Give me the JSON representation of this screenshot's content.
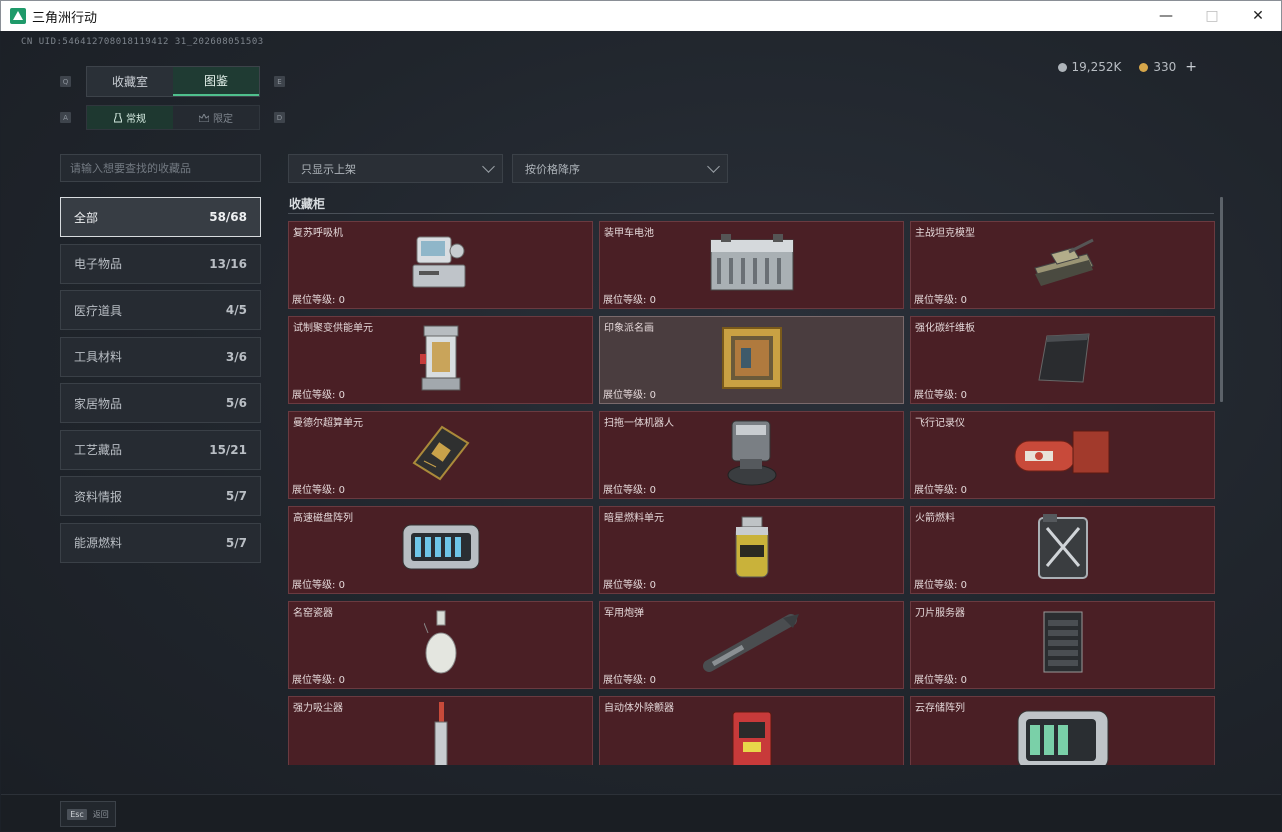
{
  "window": {
    "title": "三角洲行动",
    "icon": "delta-logo-icon"
  },
  "uid_text": "CN UID:546412708018119412 31_202608051503",
  "currency": {
    "silver": "19,252K",
    "gold": "330",
    "add_label": "+"
  },
  "key_hints": {
    "prev_tab": "Q",
    "next_tab": "E",
    "prev_sub": "A",
    "next_sub": "D"
  },
  "tabs": [
    {
      "label": "收藏室",
      "active": false
    },
    {
      "label": "图鉴",
      "active": true
    }
  ],
  "subtabs": [
    {
      "label": "常规",
      "active": true
    },
    {
      "label": "限定",
      "active": false
    }
  ],
  "search": {
    "placeholder": "请输入想要查找的收藏品"
  },
  "categories": [
    {
      "label": "全部",
      "count": "58/68",
      "active": true
    },
    {
      "label": "电子物品",
      "count": "13/16",
      "active": false
    },
    {
      "label": "医疗道具",
      "count": "4/5",
      "active": false
    },
    {
      "label": "工具材料",
      "count": "3/6",
      "active": false
    },
    {
      "label": "家居物品",
      "count": "5/6",
      "active": false
    },
    {
      "label": "工艺藏品",
      "count": "15/21",
      "active": false
    },
    {
      "label": "资料情报",
      "count": "5/7",
      "active": false
    },
    {
      "label": "能源燃料",
      "count": "5/7",
      "active": false
    }
  ],
  "filters": {
    "shelf_filter": "只显示上架",
    "sort": "按价格降序"
  },
  "section_title": "收藏柜",
  "level_label": "展位等级: ",
  "items": [
    {
      "name": "复苏呼吸机",
      "level": "0",
      "icon": "ventilator-icon",
      "highlight": false
    },
    {
      "name": "装甲车电池",
      "level": "0",
      "icon": "battery-icon",
      "highlight": false
    },
    {
      "name": "主战坦克模型",
      "level": "0",
      "icon": "tank-model-icon",
      "highlight": false
    },
    {
      "name": "试制聚变供能单元",
      "level": "0",
      "icon": "fusion-cell-icon",
      "highlight": false
    },
    {
      "name": "印象派名画",
      "level": "0",
      "icon": "painting-icon",
      "highlight": true
    },
    {
      "name": "强化碳纤维板",
      "level": "0",
      "icon": "carbon-plate-icon",
      "highlight": false
    },
    {
      "name": "曼德尔超算单元",
      "level": "0",
      "icon": "circuit-board-icon",
      "highlight": false
    },
    {
      "name": "扫拖一体机器人",
      "level": "0",
      "icon": "robot-vacuum-icon",
      "highlight": false
    },
    {
      "name": "飞行记录仪",
      "level": "0",
      "icon": "flight-recorder-icon",
      "highlight": false
    },
    {
      "name": "高速磁盘阵列",
      "level": "0",
      "icon": "disk-array-icon",
      "highlight": false
    },
    {
      "name": "暗星燃料单元",
      "level": "0",
      "icon": "fuel-cell-icon",
      "highlight": false
    },
    {
      "name": "火箭燃料",
      "level": "0",
      "icon": "jerrycan-icon",
      "highlight": false
    },
    {
      "name": "名窑瓷器",
      "level": "0",
      "icon": "porcelain-vase-icon",
      "highlight": false
    },
    {
      "name": "军用炮弹",
      "level": "0",
      "icon": "shell-icon",
      "highlight": false
    },
    {
      "name": "刀片服务器",
      "level": "0",
      "icon": "server-icon",
      "highlight": false
    },
    {
      "name": "强力吸尘器",
      "level": "",
      "icon": "vacuum-icon",
      "highlight": false
    },
    {
      "name": "自动体外除颤器",
      "level": "",
      "icon": "defibrillator-icon",
      "highlight": false
    },
    {
      "name": "云存储阵列",
      "level": "",
      "icon": "storage-array-icon",
      "highlight": false
    }
  ],
  "footer": {
    "esc_key": "Esc",
    "back_label": "返回"
  }
}
